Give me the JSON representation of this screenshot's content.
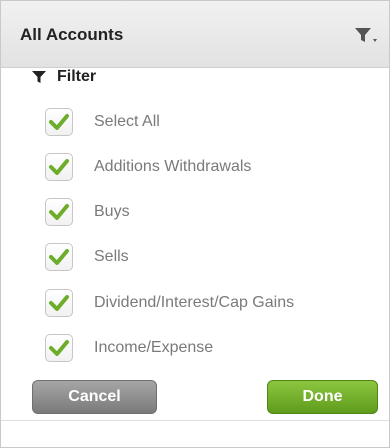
{
  "header": {
    "title": "All Accounts",
    "filter_icon": "filter-dropdown-icon"
  },
  "filter": {
    "title": "Filter",
    "icon": "filter-icon",
    "options": [
      {
        "label": "Select All",
        "checked": true
      },
      {
        "label": "Additions Withdrawals",
        "checked": true
      },
      {
        "label": "Buys",
        "checked": true
      },
      {
        "label": "Sells",
        "checked": true
      },
      {
        "label": "Dividend/Interest/Cap Gains",
        "checked": true
      },
      {
        "label": "Income/Expense",
        "checked": true
      }
    ]
  },
  "buttons": {
    "cancel_label": "Cancel",
    "done_label": "Done"
  },
  "colors": {
    "checkmark": "#6cae2b",
    "done_button": "#71ab2a",
    "cancel_button": "#8e8e8e"
  }
}
